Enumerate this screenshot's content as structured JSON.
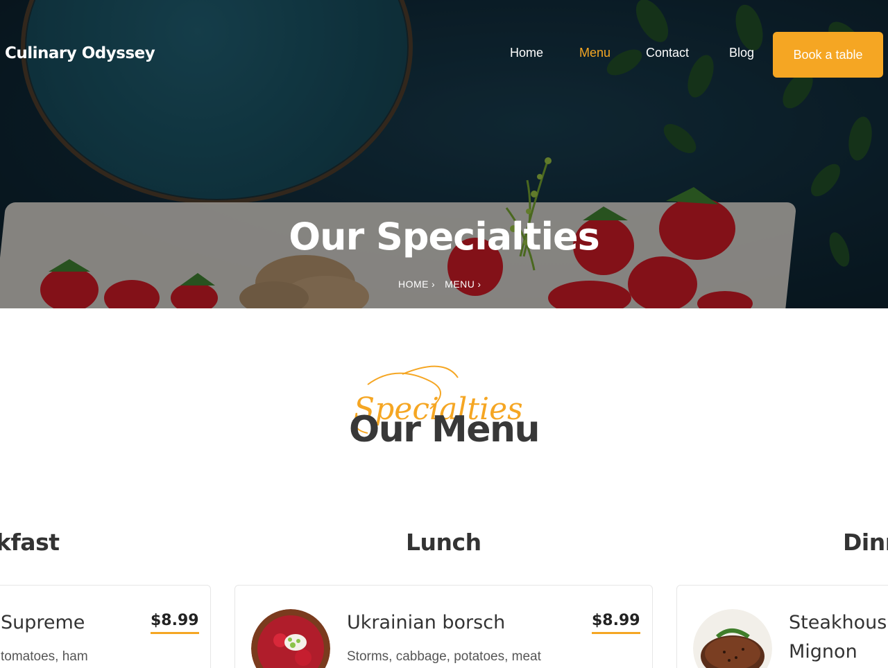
{
  "header": {
    "brand": "Culinary Odyssey",
    "nav": {
      "home": "Home",
      "menu": "Menu",
      "contact": "Contact",
      "blog": "Blog"
    },
    "book_button": "Book a table",
    "active_nav": "Menu",
    "accent_color": "#f5a623"
  },
  "hero": {
    "title": "Our Specialties",
    "breadcrumb": [
      "HOME",
      "MENU"
    ]
  },
  "section": {
    "script_text": "Specialties",
    "heading": "Our Menu"
  },
  "categories": {
    "breakfast": "kfast",
    "lunch": "Lunch",
    "dinner": "Dinn"
  },
  "cards": [
    {
      "name": "Supreme",
      "description": "tomatoes, ham",
      "price": "$8.99"
    },
    {
      "name": "Ukrainian borsch",
      "description": "Storms, cabbage, potatoes, meat",
      "price": "$8.99"
    },
    {
      "name_line1": "Steakhous",
      "name_line2": "Mignon"
    }
  ],
  "icons": [
    "chevron-right-icon"
  ]
}
